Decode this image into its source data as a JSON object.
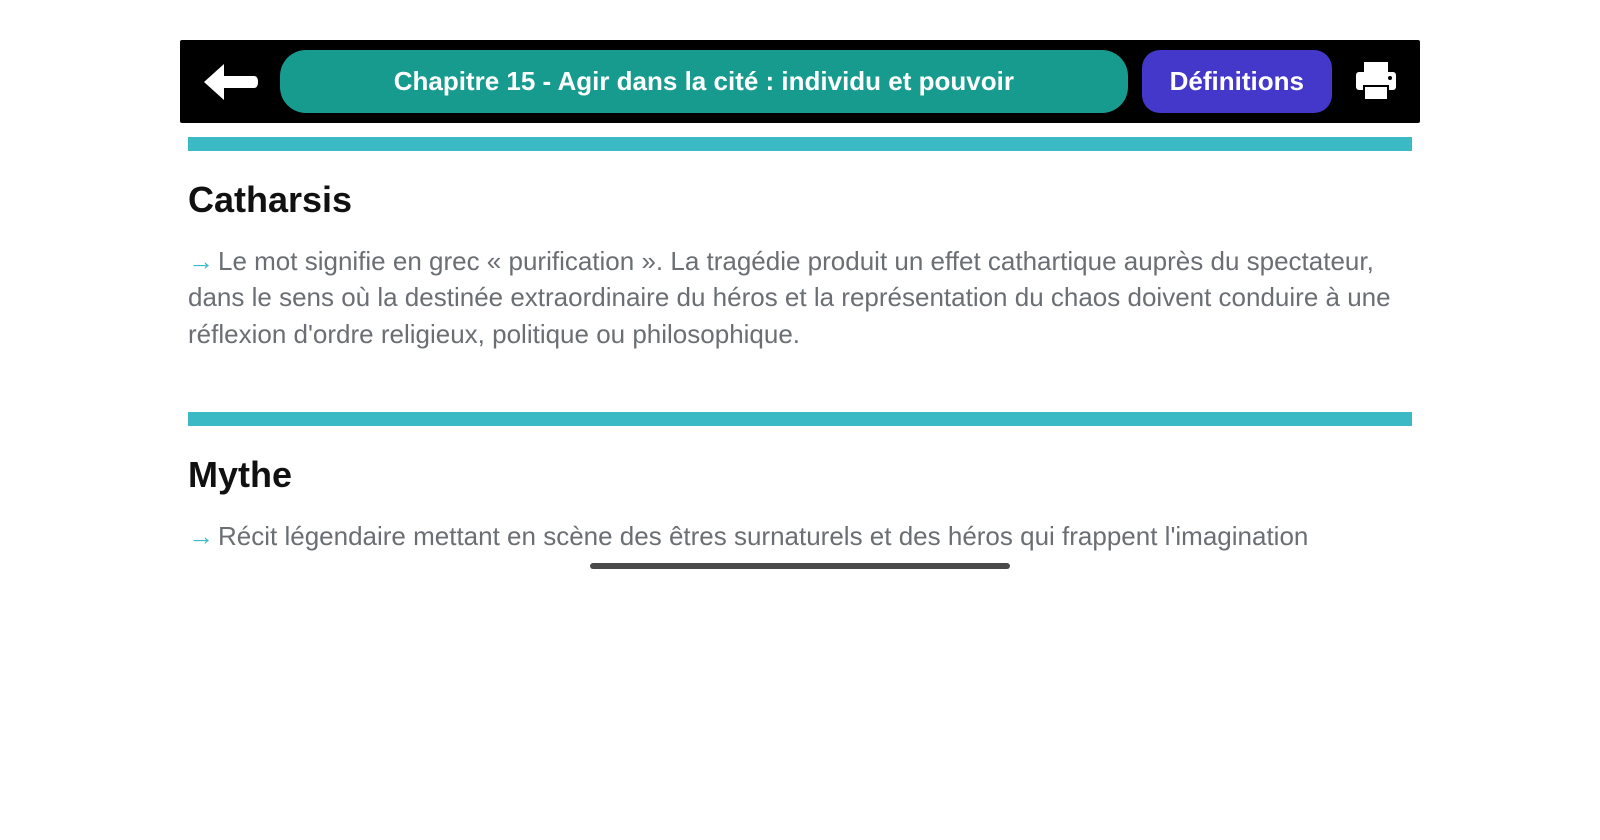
{
  "header": {
    "chapter_title": "Chapitre 15 - Agir dans la cité : individu et pouvoir",
    "definitions_label": "Définitions"
  },
  "entries": [
    {
      "term": "Catharsis",
      "definition": "Le mot signifie en grec « purification ». La tragédie produit un effet cathartique auprès du spectateur, dans le sens où la destinée extraordinaire du héros et la représentation du chaos doivent conduire à une réflexion d'ordre religieux, politique ou philosophique."
    },
    {
      "term": "Mythe",
      "definition": "Récit légendaire mettant en scène des êtres surnaturels et des héros qui frappent l'imagination"
    }
  ]
}
